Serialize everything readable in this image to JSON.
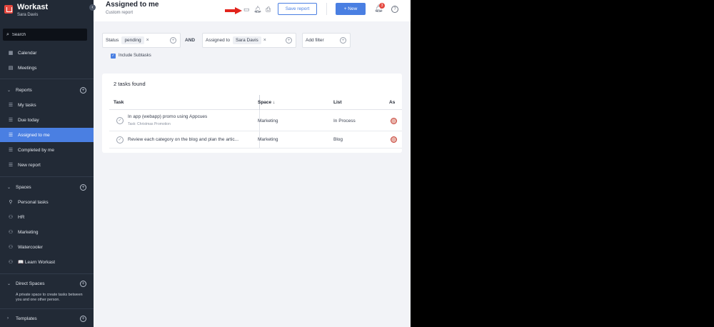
{
  "brand": {
    "name": "Workast",
    "user": "Sara Davis"
  },
  "sidebar": {
    "search_placeholder": "Search",
    "top_items": [
      {
        "label": "Calendar",
        "icon": "calendar-icon"
      },
      {
        "label": "Meetings",
        "icon": "meetings-icon"
      }
    ],
    "reports": {
      "title": "Reports",
      "items": [
        {
          "label": "My tasks"
        },
        {
          "label": "Due today"
        },
        {
          "label": "Assigned to me",
          "active": true
        },
        {
          "label": "Completed by me"
        },
        {
          "label": "New report"
        }
      ]
    },
    "spaces": {
      "title": "Spaces",
      "items": [
        {
          "label": "Personal tasks"
        },
        {
          "label": "HR"
        },
        {
          "label": "Marketing"
        },
        {
          "label": "Watercooler"
        },
        {
          "label": "📖 Learn Workast"
        }
      ]
    },
    "direct_spaces": {
      "title": "Direct Spaces",
      "hint": "A private space to create tasks between you and one other person."
    },
    "templates": {
      "title": "Templates"
    }
  },
  "header": {
    "title": "Assigned to me",
    "subtitle": "Custom report",
    "save_label": "Save report",
    "new_label": "+ New",
    "notifications_count": "3",
    "help_label": "?"
  },
  "filters": {
    "status": {
      "label": "Status",
      "value": "pending"
    },
    "and_label": "AND",
    "assigned": {
      "label": "Assigned to",
      "value": "Sara Davis"
    },
    "add_filter_label": "Add filter",
    "include_subtasks_label": "Include Subtasks"
  },
  "results": {
    "count_label": "2 tasks found",
    "columns": {
      "task": "Task",
      "space": "Space ↓",
      "list": "List",
      "assignee": "As"
    },
    "rows": [
      {
        "task": "In app (webapp) promo using Appcues",
        "subtask": "Task: Christmas Promotion",
        "space": "Marketing",
        "list": "In Process"
      },
      {
        "task": "Review each category on the blog and plan the artic...",
        "subtask": "",
        "space": "Marketing",
        "list": "Blog"
      }
    ]
  },
  "colors": {
    "sidebar": "#222a36",
    "accent": "#4a7fe2",
    "arrow": "#e2241c",
    "badge": "#e5483f"
  }
}
